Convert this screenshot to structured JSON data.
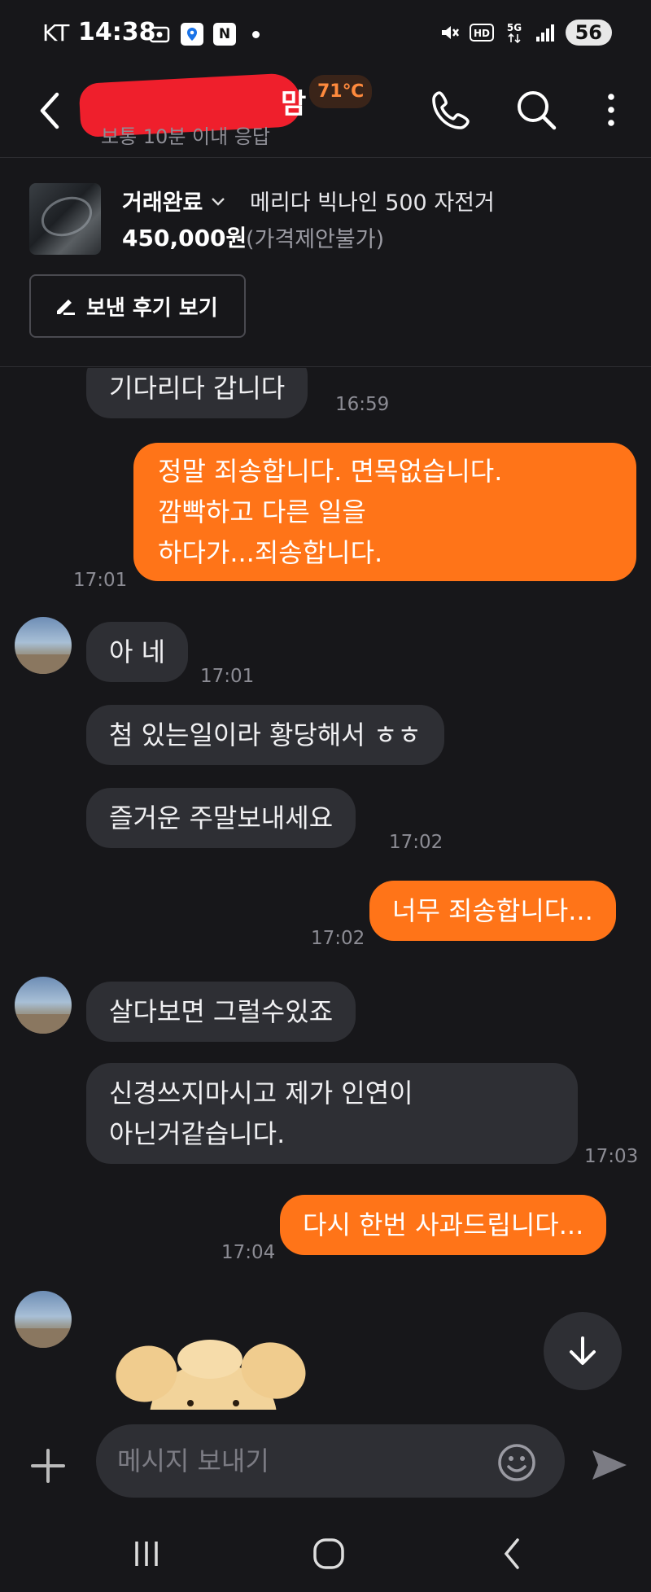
{
  "status_bar": {
    "carrier": "KT",
    "time": "14:38",
    "battery": "56"
  },
  "header": {
    "name_tail": "맘",
    "temperature": "71℃",
    "response_time": "보통 10분 이내 응답"
  },
  "item": {
    "status": "거래완료",
    "title": "메리다 빅나인 500 자전거",
    "price": "450,000원",
    "negotiation": "(가격제안불가)",
    "review_button": "보낸 후기 보기"
  },
  "messages": [
    {
      "dir": "in",
      "text": "기다리다 갑니다",
      "time": "16:59"
    },
    {
      "dir": "out",
      "text": "정말 죄송합니다. 면목없습니다.\n깜빡하고 다른 일을\n하다가...죄송합니다.",
      "time": "17:01"
    },
    {
      "dir": "in",
      "text": "아 네",
      "time": "17:01"
    },
    {
      "dir": "in",
      "text": "첨 있는일이라 황당해서 ㅎㅎ",
      "time": ""
    },
    {
      "dir": "in",
      "text": "즐거운 주말보내세요",
      "time": "17:02"
    },
    {
      "dir": "out",
      "text": "너무 죄송합니다...",
      "time": "17:02"
    },
    {
      "dir": "in",
      "text": "살다보면 그럴수있죠",
      "time": ""
    },
    {
      "dir": "in",
      "text": "신경쓰지마시고 제가 인연이\n아닌거같습니다.",
      "time": "17:03"
    },
    {
      "dir": "out",
      "text": "다시 한번 사과드립니다...",
      "time": "17:04"
    }
  ],
  "input": {
    "placeholder": "메시지 보내기"
  },
  "colors": {
    "background": "#17171a",
    "incoming_bubble": "#2e2f34",
    "outgoing_bubble": "#ff7418",
    "temperature_text": "#ff8a3d",
    "redaction": "#ef1f2c"
  }
}
